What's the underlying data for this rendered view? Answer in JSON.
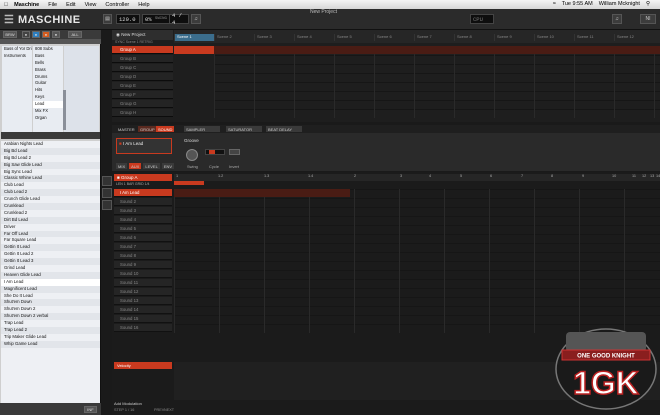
{
  "menubar": {
    "app": "Maschine",
    "items": [
      "File",
      "Edit",
      "View",
      "Controller",
      "Help"
    ],
    "status": [
      "Tue 9:55 AM",
      "William Mcknight"
    ]
  },
  "window": {
    "title": "New Project"
  },
  "header": {
    "logo": "MASCHINE",
    "tempo": "120.0",
    "swing": "0%",
    "swing_label": "SWING",
    "time_sig": "4 / 4",
    "info": "CPU"
  },
  "browser": {
    "tabs": [
      "BRW",
      "ALL"
    ],
    "col1": [
      "Bass of Yor Drip",
      "Instruments",
      "",
      "",
      "",
      "",
      "",
      "",
      "",
      ""
    ],
    "col2": [
      "808 Subs",
      "Bass",
      "Bells",
      "Brass",
      "Drums",
      "Guitar",
      "Hits",
      "Keys",
      "Lead",
      "Mix FX",
      "Organ"
    ],
    "results": [
      "Arabian Nights Lead",
      "Big Bd Lead",
      "Big Bd Lead 2",
      "Big Saw Glide Lead",
      "Big Sync Lead",
      "Classic Whine Lead",
      "Club Lead",
      "Club Lead 2",
      "Crunch Glide Lead",
      "Crunklead",
      "Crunklead 2",
      "Dirt Bd Lead",
      "Driver",
      "Far Off Lead",
      "Far Square Lead",
      "Gettin It Lead",
      "Gettin It Lead 2",
      "Gettin It Lead 3",
      "Grind Lead",
      "Heaven Glide Lead",
      "I Am Lead",
      "Magnificent Lead",
      "She Do It Lead",
      "Shut'em Down",
      "Shut'em Down 2",
      "Shut'em Down 2 verbal",
      "Trap Lead",
      "Trap Lead 2",
      "Trip Maker Glide Lead",
      "Whip Game Lead"
    ],
    "selected_index": 20,
    "footer_btn": "INF"
  },
  "arranger": {
    "project": "New Project",
    "groups": [
      "Group A",
      "Group B",
      "Group C",
      "Group D",
      "Group E",
      "Group F",
      "Group G",
      "Group H"
    ],
    "scenes": [
      "Scene 1",
      "Scene 2",
      "Scene 3",
      "Scene 4",
      "Scene 5",
      "Scene 6",
      "Scene 7",
      "Scene 8",
      "Scene 9",
      "Scene 10",
      "Scene 11",
      "Scene 12"
    ],
    "sub_labels": [
      "SYNC",
      "Scene 1",
      "RETRIG"
    ]
  },
  "control": {
    "tabs": [
      "MASTER",
      "GROUP",
      "SOUND"
    ],
    "plugins": [
      "SAMPLER",
      "SATURATOR",
      "BEAT DELAY"
    ],
    "plugin_name": "I Am Lead",
    "section": "Groove",
    "knobs": [
      "Swing",
      "Cycle",
      "Invert"
    ],
    "buttons": [
      "MIX",
      "AUX",
      "LEVEL",
      "ENV"
    ]
  },
  "pattern": {
    "group": "Group A",
    "header": [
      "LEN",
      "1 BAR",
      "GRID",
      "1/4"
    ],
    "sounds": [
      "I Am Lead",
      "Sound 2",
      "Sound 3",
      "Sound 4",
      "Sound 5",
      "Sound 6",
      "Sound 7",
      "Sound 8",
      "Sound 9",
      "Sound 10",
      "Sound 11",
      "Sound 12",
      "Sound 13",
      "Sound 14",
      "Sound 15",
      "Sound 16"
    ],
    "ruler": [
      "1",
      "1.2",
      "1.3",
      "1.4",
      "2",
      "3",
      "4",
      "5",
      "6",
      "7",
      "8",
      "9",
      "10",
      "11",
      "12",
      "13",
      "14"
    ],
    "velocity": "Velocity",
    "modulation": "Add Modulation",
    "step": "STEP 1 / 16",
    "footer": [
      "PREV",
      "NEXT"
    ]
  },
  "watermark": {
    "text": "1GK",
    "banner": "ONE GOOD KNIGHT"
  }
}
